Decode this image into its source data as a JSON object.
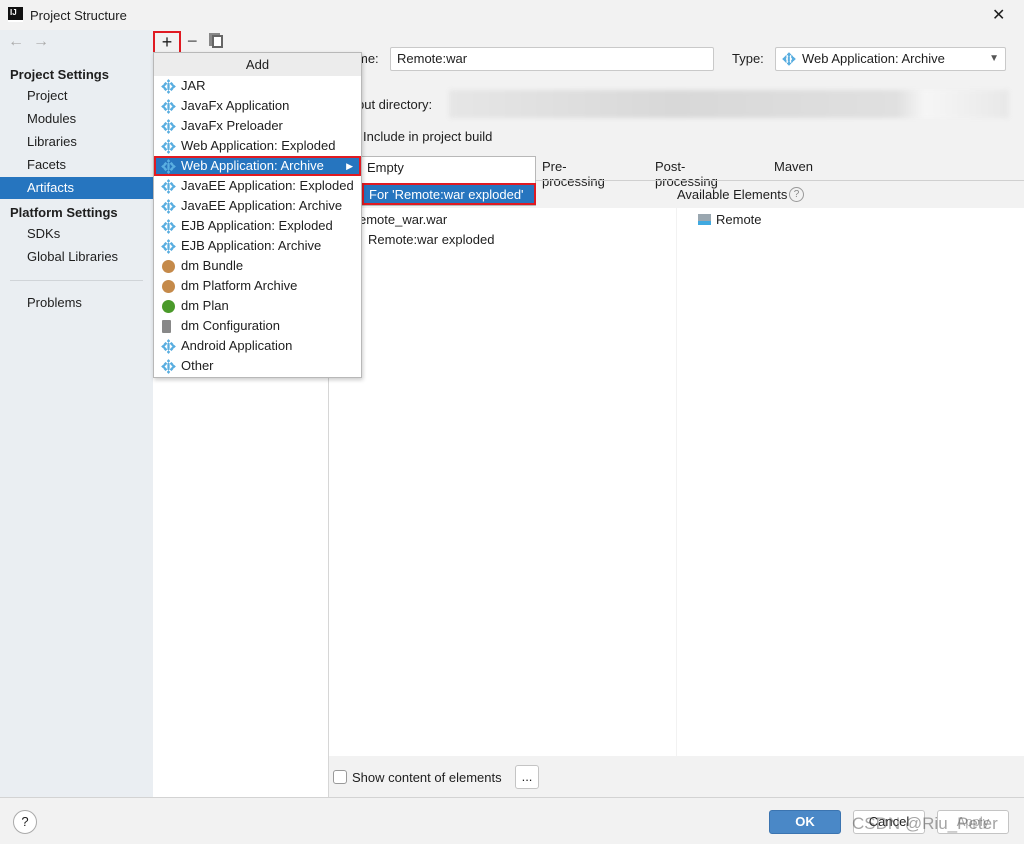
{
  "window": {
    "title": "Project Structure",
    "close": "✕"
  },
  "nav": {
    "back": "←",
    "forward": "→"
  },
  "sidebar": {
    "project_settings": "Project Settings",
    "project_items": [
      "Project",
      "Modules",
      "Libraries",
      "Facets",
      "Artifacts"
    ],
    "platform_settings": "Platform Settings",
    "platform_items": [
      "SDKs",
      "Global Libraries"
    ],
    "problems": "Problems",
    "selected": "Artifacts"
  },
  "toolbar": {
    "add": "+",
    "remove": "−"
  },
  "add_menu": {
    "title": "Add",
    "items": [
      {
        "label": "JAR",
        "icon": "jar-icon"
      },
      {
        "label": "JavaFx Application",
        "icon": "javafx-icon"
      },
      {
        "label": "JavaFx Preloader",
        "icon": "javafx-icon"
      },
      {
        "label": "Web Application: Exploded",
        "icon": "web-icon"
      },
      {
        "label": "Web Application: Archive",
        "icon": "web-icon",
        "selected": true,
        "submenu": true
      },
      {
        "label": "JavaEE Application: Exploded",
        "icon": "javaee-icon"
      },
      {
        "label": "JavaEE Application: Archive",
        "icon": "javaee-icon"
      },
      {
        "label": "EJB Application: Exploded",
        "icon": "ejb-icon"
      },
      {
        "label": "EJB Application: Archive",
        "icon": "ejb-icon"
      },
      {
        "label": "dm Bundle",
        "icon": "dm-bundle-icon"
      },
      {
        "label": "dm Platform Archive",
        "icon": "dm-platform-icon"
      },
      {
        "label": "dm Plan",
        "icon": "dm-plan-icon"
      },
      {
        "label": "dm Configuration",
        "icon": "dm-config-icon"
      },
      {
        "label": "Android Application",
        "icon": "android-icon"
      },
      {
        "label": "Other",
        "icon": "other-icon"
      }
    ]
  },
  "submenu": {
    "items": [
      "Empty",
      "For 'Remote:war exploded'"
    ],
    "selected": "For 'Remote:war exploded'"
  },
  "form": {
    "name_label": "me:",
    "name_value": "Remote:war",
    "type_label": "Type:",
    "type_value": "Web Application: Archive",
    "output_label": "put directory:",
    "include_label": "Include in project build"
  },
  "tabs": [
    "Pre-processing",
    "Post-processing",
    "Maven"
  ],
  "tree": {
    "items": [
      "emote_war.war",
      "Remote:war exploded"
    ]
  },
  "available": {
    "title": "Available Elements",
    "items": [
      "Remote"
    ]
  },
  "bottom": {
    "show_content": "Show content of elements",
    "more": "..."
  },
  "footer": {
    "ok": "OK",
    "cancel": "Cancel",
    "apply": "Apply",
    "help": "?"
  },
  "watermark": "CSDN @Riu_Peter",
  "colors": {
    "accent": "#2675bf",
    "highlight_border": "#e01a22"
  }
}
